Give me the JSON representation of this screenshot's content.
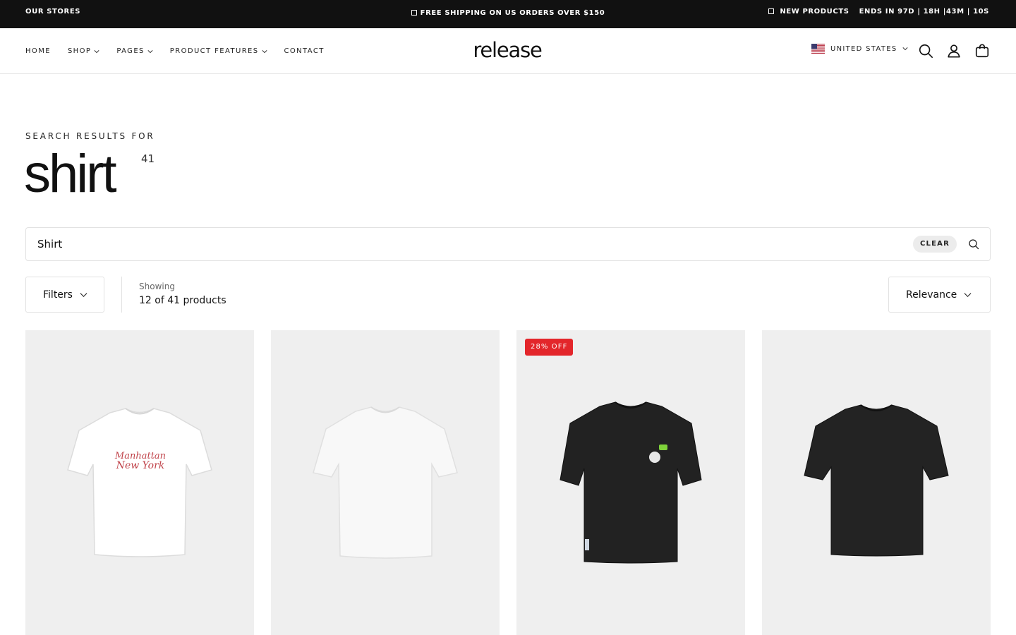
{
  "topbar": {
    "stores": "OUR STORES",
    "shipping": "FREE SHIPPING ON US ORDERS OVER $150",
    "new_products": "NEW PRODUCTS",
    "countdown": "ENDS IN 97D | 18H |43M | 10S"
  },
  "header": {
    "nav": [
      "HOME",
      "SHOP",
      "PAGES",
      "PRODUCT FEATURES",
      "CONTACT"
    ],
    "logo": "release",
    "country": "UNITED STATES"
  },
  "search": {
    "label": "SEARCH RESULTS FOR",
    "query": "shirt",
    "count": "41",
    "input_value": "Shirt",
    "clear_label": "CLEAR"
  },
  "toolbar": {
    "filters_label": "Filters",
    "showing_label": "Showing",
    "showing_value": "12 of 41 products",
    "sort_label": "Relevance"
  },
  "products": [
    {
      "image_desc": "white tee with Manhattan New York print",
      "badge": ""
    },
    {
      "image_desc": "plain white tee",
      "badge": ""
    },
    {
      "image_desc": "black tee with small graphic",
      "badge": "28% OFF"
    },
    {
      "image_desc": "plain black tee",
      "badge": ""
    }
  ],
  "product_print": {
    "line1": "Manhattan",
    "line2": "New York"
  },
  "colors": {
    "topbar_bg": "#111111",
    "badge_bg": "#e3262b",
    "card_bg": "#efefef",
    "print_red": "#c0434a"
  }
}
